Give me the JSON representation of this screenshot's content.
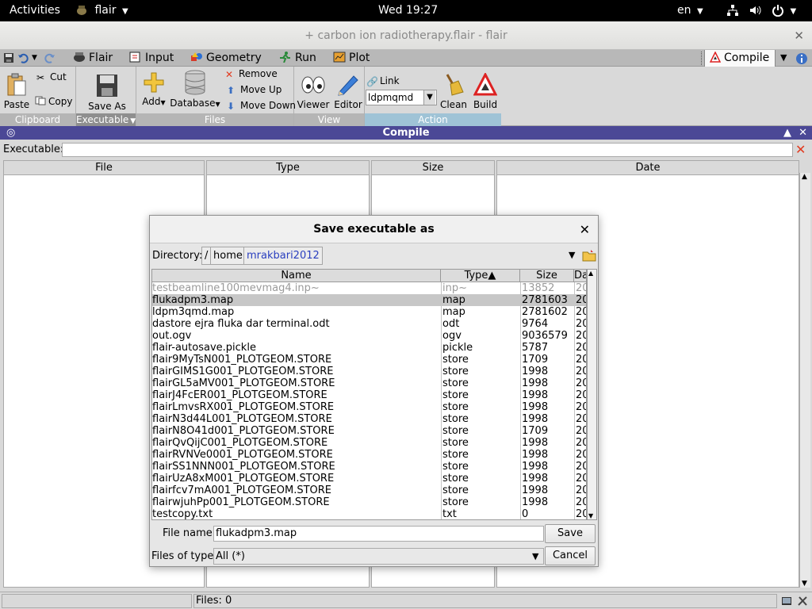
{
  "topbar": {
    "activities": "Activities",
    "app_name": "flair",
    "clock": "Wed 19:27",
    "lang": "en"
  },
  "window": {
    "title": "+ carbon ion radiotherapy.flair - flair"
  },
  "menu_tabs": {
    "flair": "Flair",
    "input": "Input",
    "geometry": "Geometry",
    "run": "Run",
    "plot": "Plot",
    "compile": "Compile"
  },
  "ribbon": {
    "clipboard": {
      "label": "Clipboard",
      "paste": "Paste",
      "cut": "Cut",
      "copy": "Copy"
    },
    "executable": {
      "label": "Executable",
      "save_as": "Save As"
    },
    "files": {
      "label": "Files",
      "add": "Add",
      "database": "Database",
      "remove": "Remove",
      "move_up": "Move Up",
      "move_down": "Move Down"
    },
    "view": {
      "label": "View",
      "viewer": "Viewer",
      "editor": "Editor"
    },
    "action": {
      "label": "Action",
      "link": "Link",
      "link_value": "ldpmqmd",
      "clean": "Clean",
      "build": "Build"
    }
  },
  "compile_panel": {
    "title": "Compile",
    "executable_label": "Executable:",
    "executable_value": "",
    "columns": [
      "File",
      "Type",
      "Size",
      "Date"
    ],
    "status_files": "Files: 0"
  },
  "dialog": {
    "title": "Save executable as",
    "directory_label": "Directory:",
    "path": [
      "/",
      "home",
      "mrakbari2012"
    ],
    "columns": {
      "name": "Name",
      "type": "Type▲",
      "size": "Size",
      "date": "Dat"
    },
    "files": [
      {
        "name": "testbeamline100mevmag4.inp~",
        "type": "inp~",
        "size": "13852",
        "date": "20"
      },
      {
        "name": "flukadpm3.map",
        "type": "map",
        "size": "2781603",
        "date": "20"
      },
      {
        "name": "ldpm3qmd.map",
        "type": "map",
        "size": "2781602",
        "date": "20"
      },
      {
        "name": "dastore ejra fluka dar terminal.odt",
        "type": "odt",
        "size": "9764",
        "date": "20"
      },
      {
        "name": "out.ogv",
        "type": "ogv",
        "size": "9036579",
        "date": "20"
      },
      {
        "name": "flair-autosave.pickle",
        "type": "pickle",
        "size": "5787",
        "date": "20"
      },
      {
        "name": "flair9MyTsN001_PLOTGEOM.STORE",
        "type": "store",
        "size": "1709",
        "date": "20"
      },
      {
        "name": "flairGIMS1G001_PLOTGEOM.STORE",
        "type": "store",
        "size": "1998",
        "date": "20"
      },
      {
        "name": "flairGL5aMV001_PLOTGEOM.STORE",
        "type": "store",
        "size": "1998",
        "date": "20"
      },
      {
        "name": "flairJ4FcER001_PLOTGEOM.STORE",
        "type": "store",
        "size": "1998",
        "date": "20"
      },
      {
        "name": "flairLmvsRX001_PLOTGEOM.STORE",
        "type": "store",
        "size": "1998",
        "date": "20"
      },
      {
        "name": "flairN3d44L001_PLOTGEOM.STORE",
        "type": "store",
        "size": "1998",
        "date": "20"
      },
      {
        "name": "flairN8O41d001_PLOTGEOM.STORE",
        "type": "store",
        "size": "1709",
        "date": "20"
      },
      {
        "name": "flairQvQijC001_PLOTGEOM.STORE",
        "type": "store",
        "size": "1998",
        "date": "20"
      },
      {
        "name": "flairRVNVe0001_PLOTGEOM.STORE",
        "type": "store",
        "size": "1998",
        "date": "20"
      },
      {
        "name": "flairSS1NNN001_PLOTGEOM.STORE",
        "type": "store",
        "size": "1998",
        "date": "20"
      },
      {
        "name": "flairUzA8xM001_PLOTGEOM.STORE",
        "type": "store",
        "size": "1998",
        "date": "20"
      },
      {
        "name": "flairfcv7mA001_PLOTGEOM.STORE",
        "type": "store",
        "size": "1998",
        "date": "20"
      },
      {
        "name": "flairwjuhPp001_PLOTGEOM.STORE",
        "type": "store",
        "size": "1998",
        "date": "20"
      },
      {
        "name": "testcopy.txt",
        "type": "txt",
        "size": "0",
        "date": "20"
      }
    ],
    "selected_index": 1,
    "file_name_label": "File name:",
    "file_name_value": "flukadpm3.map",
    "files_of_type_label": "Files of type:",
    "files_of_type_value": "All (*)",
    "save_button": "Save",
    "cancel_button": "Cancel"
  },
  "colors": {
    "panel_header": "#4b4896",
    "selected_row": "#c7c7c7",
    "remove_red": "#e23a1f"
  },
  "icons": {
    "remove": "red-x-icon",
    "move_up": "up-arrow-icon",
    "move_down": "down-arrow-icon",
    "build": "warning-triangle-icon",
    "clean": "broom-icon"
  }
}
